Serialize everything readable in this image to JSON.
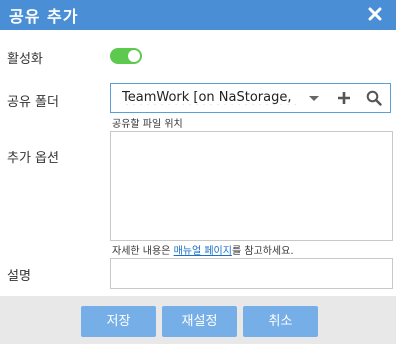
{
  "dialog": {
    "title": "공유 추가"
  },
  "fields": {
    "activate_label": "활성화",
    "activate_on": true,
    "folder_label": "공유 폴더",
    "folder_value": "TeamWork [on NaStorage,  ",
    "folder_hint": "공유할 파일 위치",
    "options_label": "추가 옵션",
    "options_hint_prefix": "자세한 내용은 ",
    "options_hint_link": "매뉴얼 페이지",
    "options_hint_suffix": "를 참고하세요.",
    "description_label": "설명"
  },
  "buttons": {
    "save": "저장",
    "reset": "재설정",
    "cancel": "취소"
  },
  "colors": {
    "titlebar": "#4a8ed6",
    "toggle_on": "#5ec94f",
    "button": "#76aee8",
    "link": "#1a6fc4"
  },
  "icons": [
    "close-icon",
    "dropdown-arrow-icon",
    "plus-icon",
    "search-icon"
  ]
}
